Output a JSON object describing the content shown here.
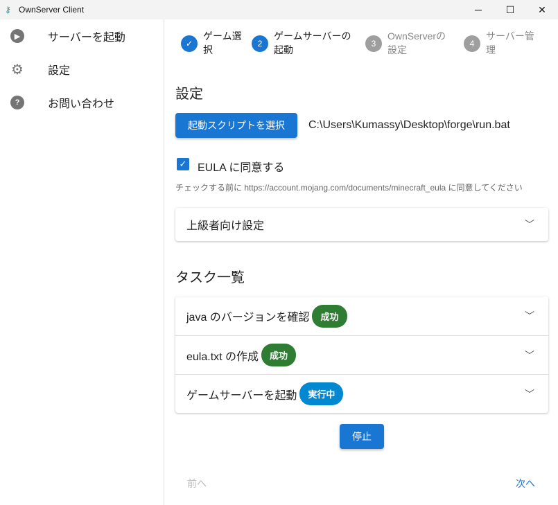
{
  "window": {
    "title": "OwnServer Client",
    "minimize": "─",
    "maximize": "☐",
    "close": "✕"
  },
  "sidebar": {
    "items": [
      {
        "label": "サーバーを起動",
        "icon": "▶"
      },
      {
        "label": "設定",
        "icon": "⚙"
      },
      {
        "label": "お問い合わせ",
        "icon": "?"
      }
    ]
  },
  "stepper": [
    {
      "label": "ゲーム選\n択",
      "icon": "✓"
    },
    {
      "label": "ゲームサーバーの\n起動",
      "num": "2"
    },
    {
      "label": "OwnServerの\n設定",
      "num": "3"
    },
    {
      "label": "サーバー管\n理",
      "num": "4"
    }
  ],
  "settings": {
    "heading": "設定",
    "select_script": "起動スクリプトを選択",
    "script_path": "C:\\Users\\Kumassy\\Desktop\\forge\\run.bat",
    "eula_label": "EULA に同意する",
    "eula_help": "チェックする前に https://account.mojang.com/documents/minecraft_eula に同意してください",
    "advanced": "上級者向け設定"
  },
  "tasks": {
    "heading": "タスク一覧",
    "items": [
      {
        "label": "java のバージョンを確認",
        "status": "成功",
        "color": "#2e7d32"
      },
      {
        "label": "eula.txt の作成",
        "status": "成功",
        "color": "#2e7d32"
      },
      {
        "label": "ゲームサーバーを起動",
        "status": "実行中",
        "color": "#0288d1"
      }
    ],
    "stop": "停止"
  },
  "nav": {
    "prev": "前へ",
    "next": "次へ"
  },
  "colors": {
    "primary": "#1976d2"
  }
}
